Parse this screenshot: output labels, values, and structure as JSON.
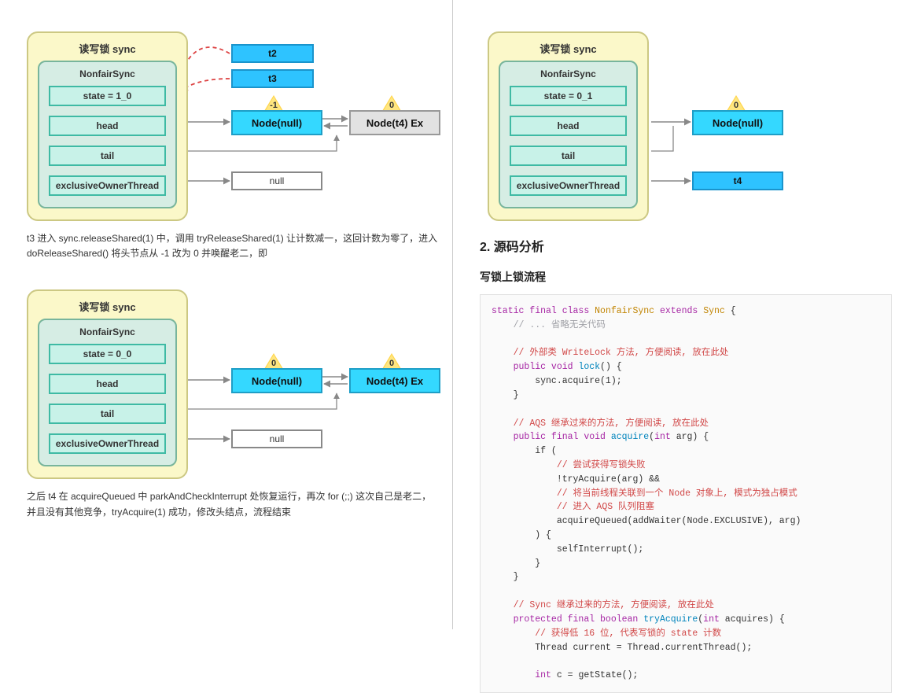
{
  "left": {
    "diagram1": {
      "sync_title": "读写锁 sync",
      "nonfair_title": "NonfairSync",
      "slots": {
        "state": "state = 1_0",
        "head": "head",
        "tail": "tail",
        "exclusive": "exclusiveOwnerThread"
      },
      "t2": "t2",
      "t3": "t3",
      "node_null": "Node(null)",
      "node_ex": "Node(t4) Ex",
      "null_box": "null",
      "tri_left": "-1",
      "tri_right": "0"
    },
    "para1": "t3 进入 sync.releaseShared(1) 中，调用 tryReleaseShared(1) 让计数减一，这回计数为零了，进入 doReleaseShared() 将头节点从 -1 改为 0 并唤醒老二，即",
    "diagram2": {
      "sync_title": "读写锁 sync",
      "nonfair_title": "NonfairSync",
      "slots": {
        "state": "state = 0_0",
        "head": "head",
        "tail": "tail",
        "exclusive": "exclusiveOwnerThread"
      },
      "node_null": "Node(null)",
      "node_ex": "Node(t4) Ex",
      "null_box": "null",
      "tri_left": "0",
      "tri_right": "0"
    },
    "para2": "之后 t4 在 acquireQueued 中 parkAndCheckInterrupt 处恢复运行，再次 for (;;) 这次自己是老二，并且没有其他竞争，tryAcquire(1) 成功，修改头结点，流程结束"
  },
  "right": {
    "diagram": {
      "sync_title": "读写锁 sync",
      "nonfair_title": "NonfairSync",
      "slots": {
        "state": "state = 0_1",
        "head": "head",
        "tail": "tail",
        "exclusive": "exclusiveOwnerThread"
      },
      "node_null": "Node(null)",
      "t4": "t4",
      "tri": "0"
    },
    "section_title": "2. 源码分析",
    "subhead": "写锁上锁流程",
    "code": {
      "l1a": "static final class",
      "l1b": "NonfairSync",
      "l1c": "extends",
      "l1d": "Sync",
      "c1": "// ... 省略无关代码",
      "c2": "// 外部类 WriteLock 方法, 方便阅读, 放在此处",
      "l2a": "public void",
      "l2b": "lock",
      "l3": "sync.acquire(1);",
      "c3": "// AQS 继承过来的方法, 方便阅读, 放在此处",
      "l4a": "public final void",
      "l4b": "acquire",
      "l4c": "int",
      "l4d": "arg",
      "l5": "if (",
      "c4": "// 尝试获得写锁失败",
      "l6": "!tryAcquire(arg) &&",
      "c5": "// 将当前线程关联到一个 Node 对象上, 模式为独占模式",
      "c6": "// 进入 AQS 队列阻塞",
      "l7": "acquireQueued(addWaiter(Node.EXCLUSIVE), arg)",
      "l8": ") {",
      "l9": "selfInterrupt();",
      "c7": "// Sync 继承过来的方法, 方便阅读, 放在此处",
      "l10a": "protected final boolean",
      "l10b": "tryAcquire",
      "l10c": "int",
      "l10d": "acquires",
      "c8": "// 获得低 16 位, 代表写锁的 state 计数",
      "l11": "Thread current = Thread.currentThread();",
      "l12a": "int",
      "l12b": "c = getState();"
    }
  }
}
